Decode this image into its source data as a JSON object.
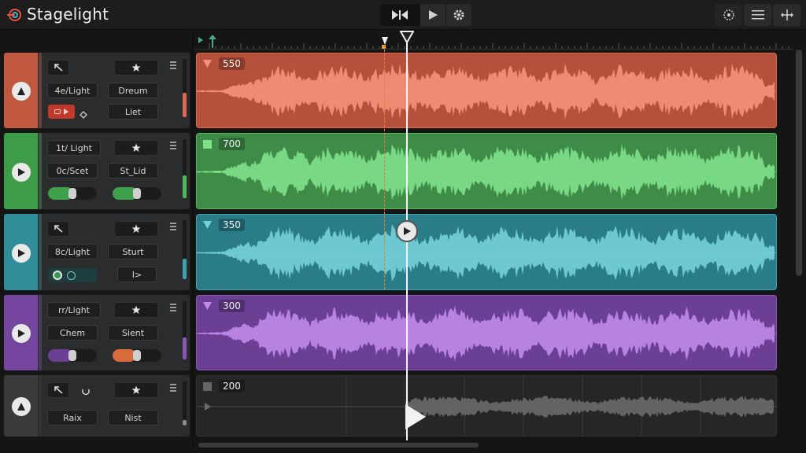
{
  "app": {
    "title": "Stagelight",
    "logo_icon": "target-logo-icon"
  },
  "transport": {
    "buttons": [
      {
        "name": "skip-to-start",
        "icon": "skip-icon"
      },
      {
        "name": "play",
        "icon": "play-icon"
      },
      {
        "name": "settings",
        "icon": "gear-icon"
      }
    ]
  },
  "toolbar_right": {
    "buttons": [
      {
        "name": "snap",
        "icon": "cog-dial-icon"
      },
      {
        "name": "menu",
        "icon": "hamburger-icon"
      },
      {
        "name": "split",
        "icon": "split-icon"
      }
    ]
  },
  "tracks": [
    {
      "color": "#e0684e",
      "strip_color": "#c0573f",
      "meter_color": "#e0684e",
      "meter_level": 0.42,
      "arm_icon": "triangle-up-icon",
      "btn_a": "4e/Light",
      "btn_b": "Dreum",
      "btn_c": "Liet",
      "btn_d_icon": "ab",
      "btn_e_icon": "diamond-icon",
      "top_left_icon": "arrow-up-left-icon",
      "top_right_icon": "star-icon",
      "clip_label": "550",
      "clip_fill": "#b5503a",
      "wave_color": "#f5907a"
    },
    {
      "color": "#4fb85a",
      "strip_color": "#3c9c48",
      "meter_color": "#4fb85a",
      "meter_level": 0.38,
      "arm_icon": "play-icon",
      "btn_a": "1t/ Light",
      "btn_b": "0c/Scet",
      "btn_c": "St_Lid",
      "top_right_icon": "star-icon",
      "clip_label": "700",
      "clip_fill": "#3e8c47",
      "wave_color": "#7ee08a"
    },
    {
      "color": "#3aa3b0",
      "strip_color": "#2f8e9a",
      "meter_color": "#3aa3b0",
      "meter_level": 0.35,
      "arm_icon": "play-icon",
      "btn_a": "8c/Light",
      "btn_b": "Sturt",
      "btn_c": "I>",
      "top_left_icon": "arrow-up-left-icon",
      "top_right_icon": "star-icon",
      "clip_label": "350",
      "clip_fill": "#2a7c88",
      "wave_color": "#74d0da"
    },
    {
      "color": "#8a55b8",
      "strip_color": "#7446a0",
      "meter_color": "#8a55b8",
      "meter_level": 0.38,
      "arm_icon": "play-icon",
      "btn_a": "rr/Light",
      "btn_b": "Chem",
      "btn_c": "Sient",
      "top_right_icon": "star-icon",
      "clip_label": "300",
      "clip_fill": "#6a3f94",
      "wave_color": "#c08ae8"
    },
    {
      "color": "#444444",
      "strip_color": "#3a3a3a",
      "meter_color": "#8a8a8a",
      "meter_level": 0.12,
      "arm_icon": "triangle-up-icon",
      "btn_a": "Raix",
      "btn_b": "Nist",
      "top_left_icon": "arrow-up-left-icon",
      "top_mid_icon": "rec-icon",
      "top_right_icon": "star-icon",
      "clip_label": "200",
      "clip_fill": "#262626",
      "wave_color": "#6a6a6a"
    }
  ],
  "playhead_icon": "play-icon"
}
